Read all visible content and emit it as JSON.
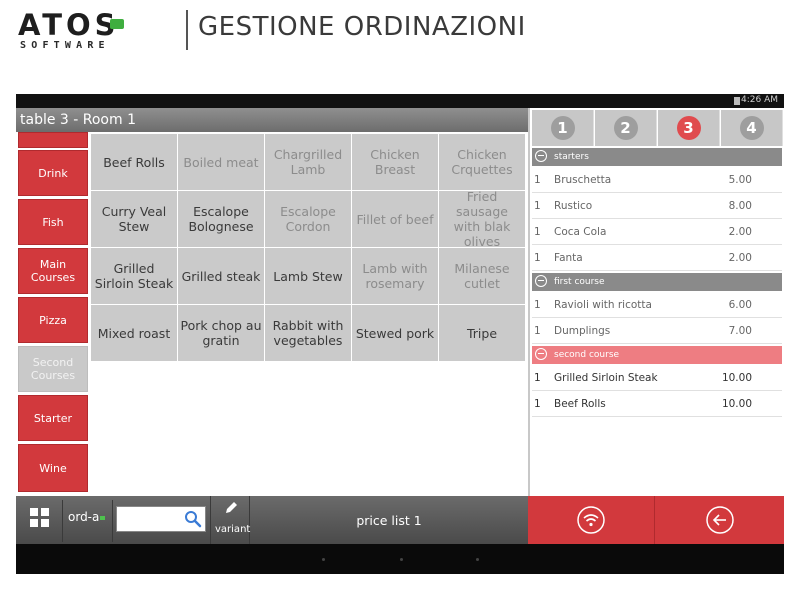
{
  "header": {
    "logo_main": "ATOS",
    "logo_sub": "SOFTWARE",
    "title": "GESTIONE ORDINAZIONI"
  },
  "status": {
    "time": "4:26 AM"
  },
  "table_title": "table 3 - Room 1",
  "categories": [
    {
      "label": ""
    },
    {
      "label": "Drink"
    },
    {
      "label": "Fish"
    },
    {
      "label": "Main Courses"
    },
    {
      "label": "Pizza"
    },
    {
      "label": "Second Courses"
    },
    {
      "label": "Starter"
    },
    {
      "label": "Wine"
    }
  ],
  "products": [
    {
      "label": "Beef Rolls"
    },
    {
      "label": "Boiled meat"
    },
    {
      "label": "Chargrilled Lamb"
    },
    {
      "label": "Chicken Breast"
    },
    {
      "label": "Chicken Crquettes"
    },
    {
      "label": "Curry Veal Stew"
    },
    {
      "label": "Escalope Bolognese"
    },
    {
      "label": "Escalope Cordon"
    },
    {
      "label": "Fillet of beef"
    },
    {
      "label": "Fried sausage with blak olives"
    },
    {
      "label": "Grilled Sirloin Steak"
    },
    {
      "label": "Grilled steak"
    },
    {
      "label": "Lamb Stew"
    },
    {
      "label": "Lamb with rosemary"
    },
    {
      "label": "Milanese cutlet"
    },
    {
      "label": "Mixed roast"
    },
    {
      "label": "Pork chop au gratin"
    },
    {
      "label": "Rabbit with vegetables"
    },
    {
      "label": "Stewed pork"
    },
    {
      "label": "Tripe"
    }
  ],
  "course_tabs": [
    "1",
    "2",
    "3",
    "4"
  ],
  "order": {
    "sections": [
      {
        "label": "starters"
      },
      {
        "label": "first course"
      },
      {
        "label": "second course"
      }
    ],
    "rows": [
      {
        "qty": "1",
        "name": "Bruschetta",
        "price": "5.00"
      },
      {
        "qty": "1",
        "name": "Rustico",
        "price": "8.00"
      },
      {
        "qty": "1",
        "name": "Coca Cola",
        "price": "2.00"
      },
      {
        "qty": "1",
        "name": "Fanta",
        "price": "2.00"
      },
      {
        "qty": "1",
        "name": "Ravioli with ricotta",
        "price": "6.00"
      },
      {
        "qty": "1",
        "name": "Dumplings",
        "price": "7.00"
      },
      {
        "qty": "1",
        "name": "Grilled Sirloin Steak",
        "price": "10.00"
      },
      {
        "qty": "1",
        "name": "Beef Rolls",
        "price": "10.00"
      }
    ]
  },
  "bottom": {
    "ord_label": "ord-a",
    "search_value": "",
    "variant_label": "variant",
    "price_list": "price list 1"
  },
  "colors": {
    "accent_red": "#d2393d",
    "active_course": "#e04b4e",
    "section_highlight": "#ee7d82",
    "tile_gray": "#cacaca"
  },
  "icons": {
    "menu": "grid-icon",
    "search": "search-icon",
    "edit": "pencil-icon",
    "send": "wifi-icon",
    "back": "back-arrow-icon",
    "collapse": "minus-circle-icon"
  }
}
